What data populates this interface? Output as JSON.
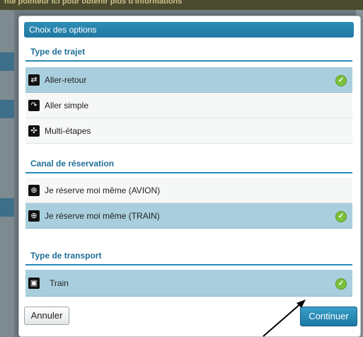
{
  "background": {
    "banner_text": "nte pointeur ici pour obtenir plus d'informations"
  },
  "dialog": {
    "title": "Choix des options",
    "sections": {
      "trip_type": {
        "title": "Type de trajet",
        "options": [
          {
            "label": "Aller-retour",
            "icon": "round-trip-icon",
            "selected": true
          },
          {
            "label": "Aller simple",
            "icon": "one-way-icon",
            "selected": false
          },
          {
            "label": "Multi-étapes",
            "icon": "multi-stop-icon",
            "selected": false
          }
        ]
      },
      "booking_channel": {
        "title": "Canal de réservation",
        "options": [
          {
            "label": "Je réserve moi même (AVION)",
            "icon": "self-booking-icon",
            "selected": false
          },
          {
            "label": "Je réserve moi même (TRAIN)",
            "icon": "self-booking-icon",
            "selected": true
          }
        ]
      },
      "transport_type": {
        "title": "Type de transport",
        "options": [
          {
            "label": "Train",
            "icon": "train-icon",
            "selected": true
          }
        ]
      }
    },
    "buttons": {
      "cancel": "Annuler",
      "continue": "Continuer"
    }
  },
  "colors": {
    "accent": "#1f78a2",
    "selected_row": "#a9cfde",
    "check": "#7bc13c"
  }
}
